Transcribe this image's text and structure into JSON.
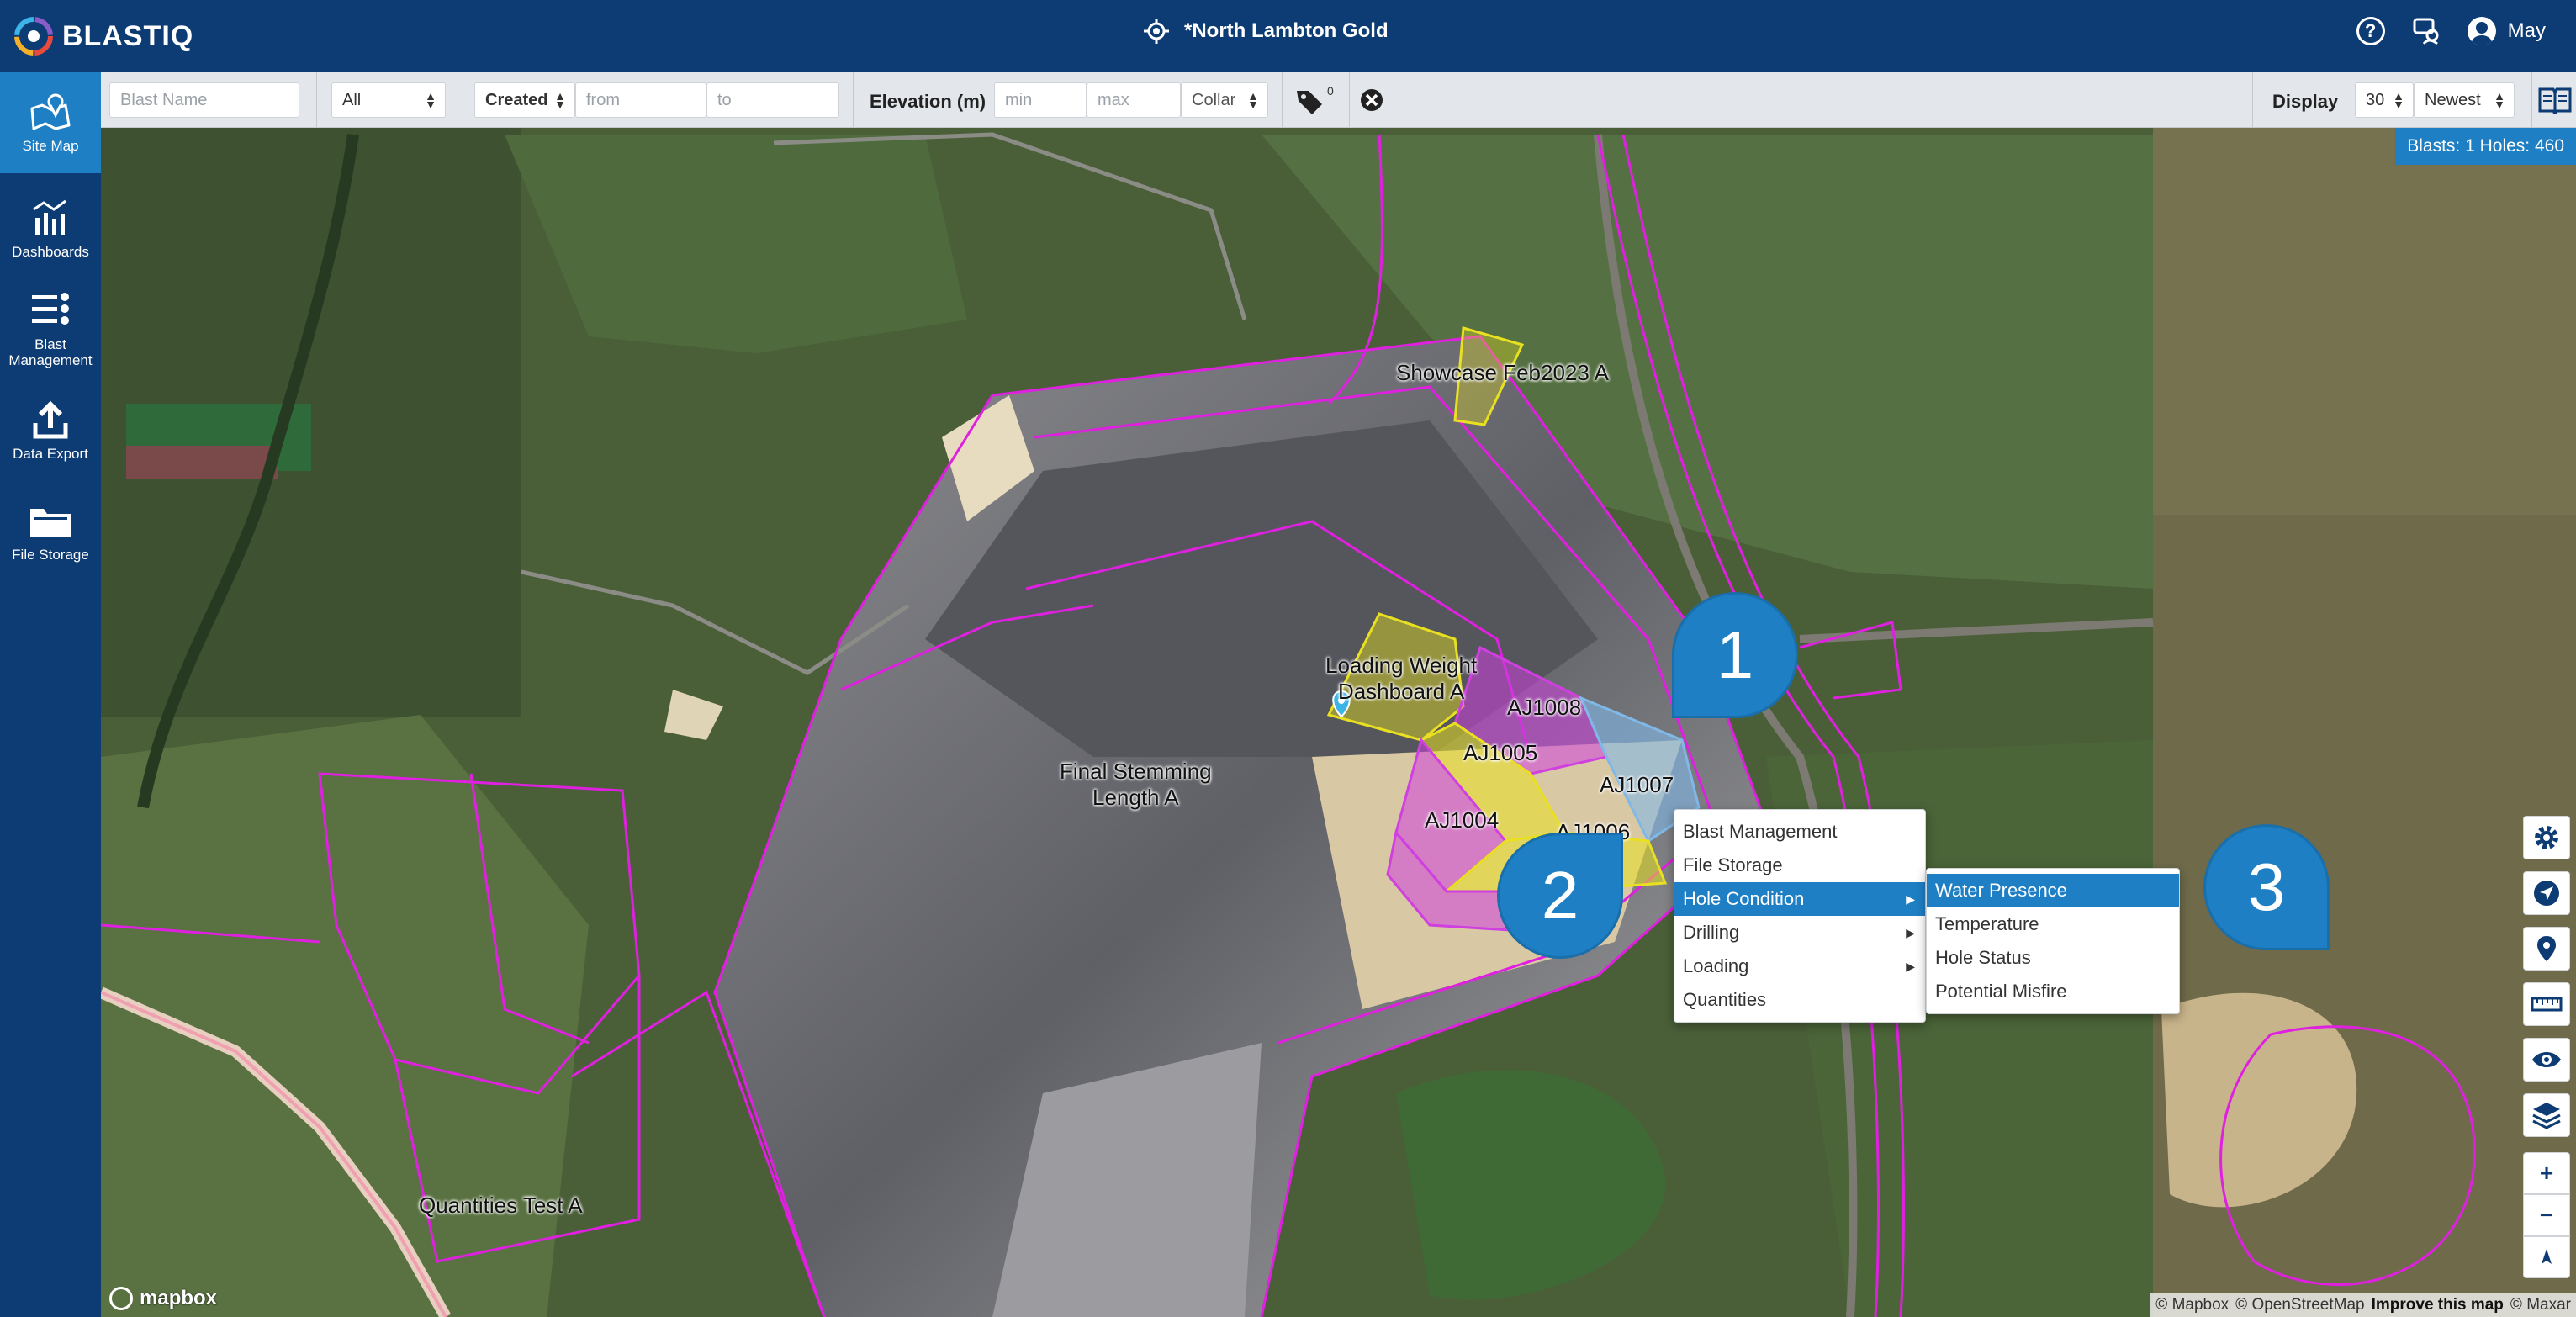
{
  "app": {
    "name": "BLASTIQ",
    "site_name": "*North Lambton Gold",
    "user_name": "May"
  },
  "sidebar": {
    "items": [
      {
        "label": "Site Map",
        "icon": "map-icon"
      },
      {
        "label": "Dashboards",
        "icon": "dashboard-icon"
      },
      {
        "label": "Blast Management",
        "icon": "blast-management-icon"
      },
      {
        "label": "Data Export",
        "icon": "upload-icon"
      },
      {
        "label": "File Storage",
        "icon": "folder-icon"
      }
    ]
  },
  "filters": {
    "blast_name_placeholder": "Blast Name",
    "type_value": "All",
    "date_field_value": "Created",
    "date_from_placeholder": "from",
    "date_to_placeholder": "to",
    "elevation_label": "Elevation (m)",
    "elevation_min_placeholder": "min",
    "elevation_max_placeholder": "max",
    "elevation_ref_value": "Collar",
    "tag_count": "0",
    "display_label": "Display",
    "display_count_value": "30",
    "sort_value": "Newest"
  },
  "map": {
    "counts_text": "Blasts: 1 Holes: 460",
    "labels": {
      "showcase": "Showcase Feb2023 A",
      "loading_weight_1": "Loading Weight",
      "loading_weight_2": "Dashboard A",
      "final_stemming_1": "Final Stemming",
      "final_stemming_2": "Length A",
      "quantities": "Quantities Test A",
      "aj1008": "AJ1008",
      "aj1005": "AJ1005",
      "aj1007": "AJ1007",
      "aj1004": "AJ1004",
      "aj1006": "AJ1006"
    },
    "mapbox_label": "mapbox",
    "attribution": {
      "mapbox": "© Mapbox",
      "osm": "© OpenStreetMap",
      "improve": "Improve this map",
      "maxar": "© Maxar"
    }
  },
  "context_menu": {
    "items": [
      "Blast Management",
      "File Storage",
      "Hole Condition",
      "Drilling",
      "Loading",
      "Quantities"
    ],
    "selected": "Hole Condition",
    "submenu": [
      "Water Presence",
      "Temperature",
      "Hole Status",
      "Potential Misfire"
    ],
    "submenu_selected": "Water Presence"
  },
  "callouts": [
    "1",
    "2",
    "3"
  ],
  "map_controls": [
    "settings-icon",
    "navigation-icon",
    "location-pin-icon",
    "ruler-icon",
    "eye-icon",
    "layers-icon",
    "zoom-in-icon",
    "zoom-out-icon",
    "compass-icon"
  ],
  "colors": {
    "header": "#0d3b73",
    "accent": "#1e7fc4",
    "boundary": "#e020e0",
    "blast_yellow": "#e8e020",
    "blast_magenta": "#d040e0",
    "blast_blue": "#80b8e8"
  }
}
